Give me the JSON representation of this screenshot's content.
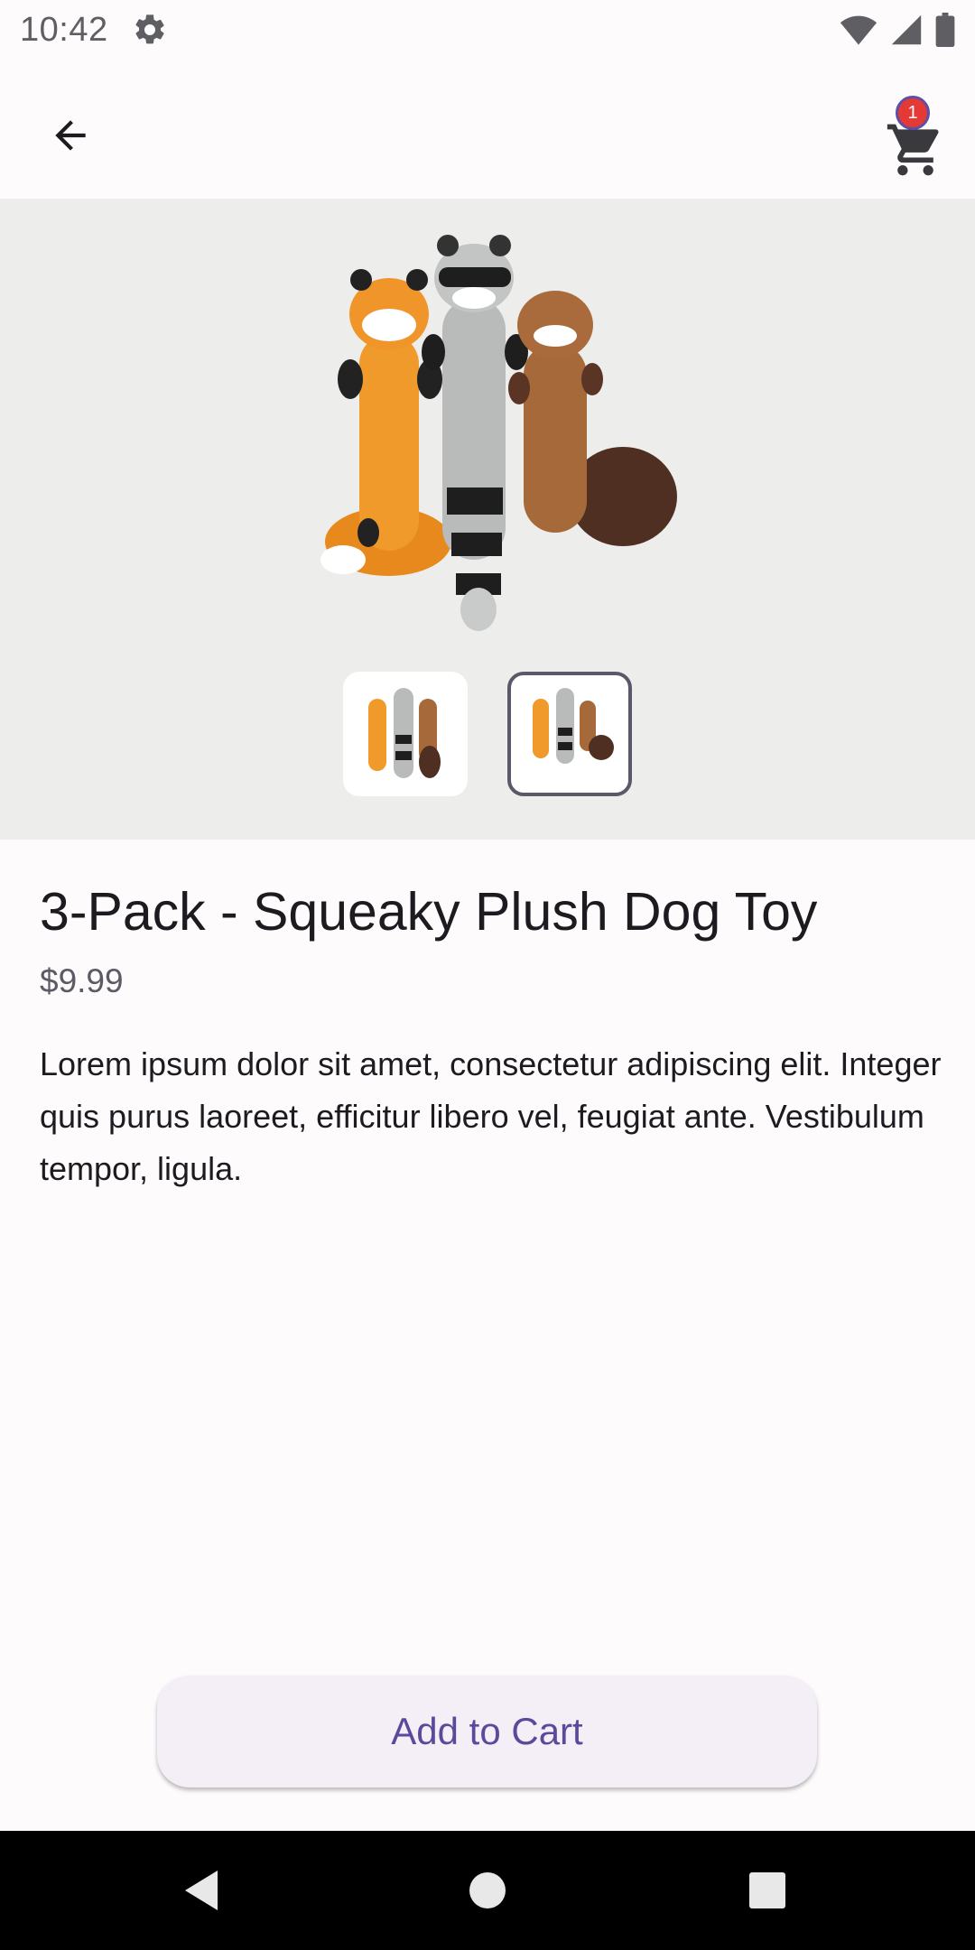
{
  "status_bar": {
    "time": "10:42"
  },
  "app_bar": {
    "cart_count": "1"
  },
  "product": {
    "title": "3-Pack - Squeaky Plush Dog Toy",
    "price": "$9.99",
    "description": "Lorem ipsum dolor sit amet, consectetur adipiscing elit. Integer quis purus laoreet, efficitur libero vel, feugiat ante. Vestibulum tempor, ligula."
  },
  "gallery": {
    "thumbnails": [
      "thumbnail-1",
      "thumbnail-2"
    ],
    "selected_index": 1
  },
  "actions": {
    "add_to_cart_label": "Add to Cart"
  },
  "colors": {
    "accent": "#5a4a9c",
    "badge": "#e53935",
    "gallery_bg": "#edeeec"
  }
}
